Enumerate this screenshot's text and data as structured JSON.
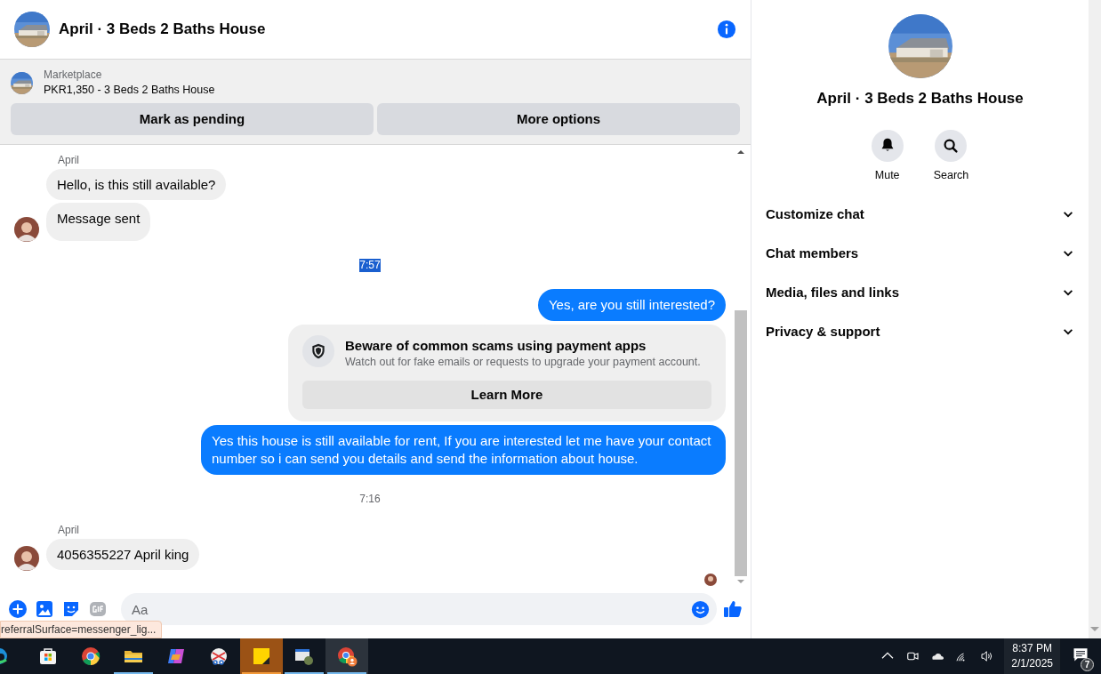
{
  "header": {
    "title": "April · 3 Beds 2 Baths House"
  },
  "listing": {
    "label": "Marketplace",
    "text": "PKR1,350 - 3 Beds 2 Baths House",
    "buttons": [
      "Mark as pending",
      "More options"
    ]
  },
  "messages": [
    {
      "kind": "sender",
      "text": "April"
    },
    {
      "kind": "incoming",
      "text": "Hello, is this still available?",
      "avatar": false
    },
    {
      "kind": "incoming",
      "text": "Message sent",
      "avatar": true
    },
    {
      "kind": "timestamp",
      "text": "7:57",
      "highlighted": true
    },
    {
      "kind": "outgoing",
      "text": "Yes, are you still interested?"
    },
    {
      "kind": "notice",
      "title": "Beware of common scams using payment apps",
      "text": "Watch out for fake emails or requests to upgrade your payment account.",
      "button": "Learn More"
    },
    {
      "kind": "outgoing",
      "text": "Yes this house is still available for rent,  If you are interested  let me have your contact number so i can send you details and send the information about house."
    },
    {
      "kind": "timestamp",
      "text": "7:16",
      "highlighted": false
    },
    {
      "kind": "sender",
      "text": "April"
    },
    {
      "kind": "incoming",
      "text": "4056355227 April king",
      "avatar": true
    },
    {
      "kind": "seen"
    }
  ],
  "composer": {
    "placeholder": "Aa"
  },
  "status_url": "referralSurface=messenger_lig...",
  "sidebar": {
    "title": "April · 3 Beds 2 Baths House",
    "actions": [
      {
        "kind": "bell",
        "label": "Mute"
      },
      {
        "kind": "search",
        "label": "Search"
      }
    ],
    "sections": [
      {
        "label": "Customize chat",
        "expanded": false
      },
      {
        "label": "Chat members",
        "expanded": false
      },
      {
        "label": "Media, files and links",
        "expanded": false
      },
      {
        "label": "Privacy & support",
        "expanded": false
      }
    ]
  },
  "taskbar": {
    "apps": [
      {
        "kind": "edge",
        "running": false,
        "selected": false
      },
      {
        "kind": "store",
        "running": false,
        "selected": false
      },
      {
        "kind": "chrome",
        "running": false,
        "selected": false
      },
      {
        "kind": "folder",
        "running": true,
        "selected": false
      },
      {
        "kind": "copilot",
        "running": false,
        "selected": false
      },
      {
        "kind": "snip",
        "running": false,
        "selected": false
      },
      {
        "kind": "notes",
        "running": true,
        "selected": false,
        "flashing": true
      },
      {
        "kind": "window",
        "running": true,
        "selected": false
      },
      {
        "kind": "chrome-profile",
        "running": true,
        "selected": true
      }
    ],
    "time": "8:37 PM",
    "date": "2/1/2025",
    "notifications": "7"
  }
}
